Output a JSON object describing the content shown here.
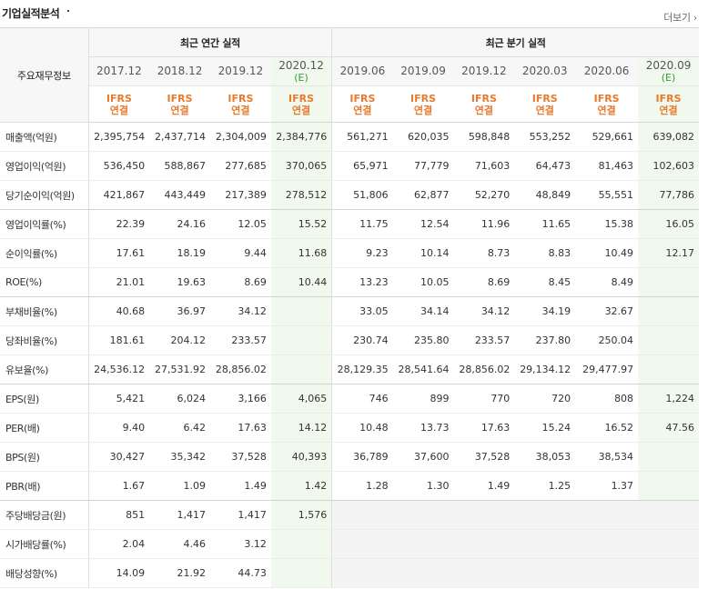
{
  "section": {
    "title": "기업실적분석",
    "more": "더보기"
  },
  "header": {
    "row_label": "주요재무정보",
    "annual_group": "최근 연간 실적",
    "quarter_group": "최근 분기 실적",
    "periods": [
      {
        "label": "2017.12",
        "est": ""
      },
      {
        "label": "2018.12",
        "est": ""
      },
      {
        "label": "2019.12",
        "est": ""
      },
      {
        "label": "2020.12",
        "est": "(E)"
      },
      {
        "label": "2019.06",
        "est": ""
      },
      {
        "label": "2019.09",
        "est": ""
      },
      {
        "label": "2019.12",
        "est": ""
      },
      {
        "label": "2020.03",
        "est": ""
      },
      {
        "label": "2020.06",
        "est": ""
      },
      {
        "label": "2020.09",
        "est": "(E)"
      }
    ],
    "ifrs_line1": "IFRS",
    "ifrs_line2": "연결"
  },
  "rows": [
    {
      "label": "매출액(억원)",
      "values": [
        "2,395,754",
        "2,437,714",
        "2,304,009",
        "2,384,776",
        "561,271",
        "620,035",
        "598,848",
        "553,252",
        "529,661",
        "639,082"
      ]
    },
    {
      "label": "영업이익(억원)",
      "values": [
        "536,450",
        "588,867",
        "277,685",
        "370,065",
        "65,971",
        "77,779",
        "71,603",
        "64,473",
        "81,463",
        "102,603"
      ]
    },
    {
      "label": "당기순이익(억원)",
      "values": [
        "421,867",
        "443,449",
        "217,389",
        "278,512",
        "51,806",
        "62,877",
        "52,270",
        "48,849",
        "55,551",
        "77,786"
      ]
    },
    {
      "label": "영업이익률(%)",
      "values": [
        "22.39",
        "24.16",
        "12.05",
        "15.52",
        "11.75",
        "12.54",
        "11.96",
        "11.65",
        "15.38",
        "16.05"
      ]
    },
    {
      "label": "순이익률(%)",
      "values": [
        "17.61",
        "18.19",
        "9.44",
        "11.68",
        "9.23",
        "10.14",
        "8.73",
        "8.83",
        "10.49",
        "12.17"
      ]
    },
    {
      "label": "ROE(%)",
      "values": [
        "21.01",
        "19.63",
        "8.69",
        "10.44",
        "13.23",
        "10.05",
        "8.69",
        "8.45",
        "8.49",
        ""
      ]
    },
    {
      "label": "부채비율(%)",
      "values": [
        "40.68",
        "36.97",
        "34.12",
        "",
        "33.05",
        "34.14",
        "34.12",
        "34.19",
        "32.67",
        ""
      ]
    },
    {
      "label": "당좌비율(%)",
      "values": [
        "181.61",
        "204.12",
        "233.57",
        "",
        "230.74",
        "235.80",
        "233.57",
        "237.80",
        "250.04",
        ""
      ]
    },
    {
      "label": "유보율(%)",
      "values": [
        "24,536.12",
        "27,531.92",
        "28,856.02",
        "",
        "28,129.35",
        "28,541.64",
        "28,856.02",
        "29,134.12",
        "29,477.97",
        ""
      ]
    },
    {
      "label": "EPS(원)",
      "values": [
        "5,421",
        "6,024",
        "3,166",
        "4,065",
        "746",
        "899",
        "770",
        "720",
        "808",
        "1,224"
      ]
    },
    {
      "label": "PER(배)",
      "values": [
        "9.40",
        "6.42",
        "17.63",
        "14.12",
        "10.48",
        "13.73",
        "17.63",
        "15.24",
        "16.52",
        "47.56"
      ]
    },
    {
      "label": "BPS(원)",
      "values": [
        "30,427",
        "35,342",
        "37,528",
        "40,393",
        "36,789",
        "37,600",
        "37,528",
        "38,053",
        "38,534",
        ""
      ]
    },
    {
      "label": "PBR(배)",
      "values": [
        "1.67",
        "1.09",
        "1.49",
        "1.42",
        "1.28",
        "1.30",
        "1.49",
        "1.25",
        "1.37",
        ""
      ]
    },
    {
      "label": "주당배당금(원)",
      "values": [
        "851",
        "1,417",
        "1,417",
        "1,576",
        "",
        "",
        "",
        "",
        "",
        ""
      ]
    },
    {
      "label": "시가배당률(%)",
      "values": [
        "2.04",
        "4.46",
        "3.12",
        "",
        "",
        "",
        "",
        "",
        "",
        ""
      ]
    },
    {
      "label": "배당성향(%)",
      "values": [
        "14.09",
        "21.92",
        "44.73",
        "",
        "",
        "",
        "",
        "",
        "",
        ""
      ]
    }
  ],
  "group_end_rows": [
    2,
    5,
    8,
    12
  ]
}
